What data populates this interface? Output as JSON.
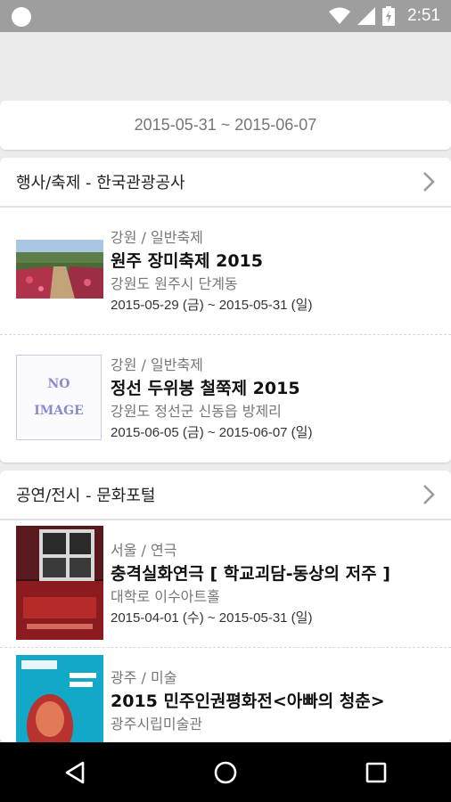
{
  "status_bar": {
    "time": "2:51"
  },
  "date_filter": {
    "range": "2015-05-31 ~ 2015-06-07"
  },
  "sections": [
    {
      "title": "행사/축제 - 한국관광공사",
      "items": [
        {
          "category": "강원 / 일반축제",
          "title": "원주 장미축제 2015",
          "address": "강원도 원주시 단계동",
          "dates": "2015-05-29 (금) ~ 2015-05-31 (일)"
        },
        {
          "category": "강원 / 일반축제",
          "title": "정선 두위봉 철쭉제 2015",
          "address": "강원도 정선군 신동읍 방제리",
          "dates": "2015-06-05 (금) ~ 2015-06-07 (일)",
          "no_image": [
            "NO",
            "IMAGE"
          ]
        }
      ]
    },
    {
      "title": "공연/전시 - 문화포털",
      "items": [
        {
          "category": "서울 / 연극",
          "title": "충격실화연극 [ 학교괴담-동상의 저주 ]",
          "address": "대학로 이수아트홀",
          "dates": "2015-04-01 (수) ~ 2015-05-31 (일)"
        },
        {
          "category": "광주 / 미술",
          "title": "2015 민주인권평화전<아빠의 청춘>",
          "address": "광주시립미술관",
          "dates": ""
        }
      ]
    }
  ],
  "icons": {
    "chevron": "chevron-right-icon",
    "back": "back-icon",
    "home": "home-icon",
    "recents": "recents-icon"
  },
  "colors": {
    "status_bar": "#9e9e9e",
    "background": "#ececec",
    "card": "#ffffff",
    "nav_bar": "#000000"
  }
}
